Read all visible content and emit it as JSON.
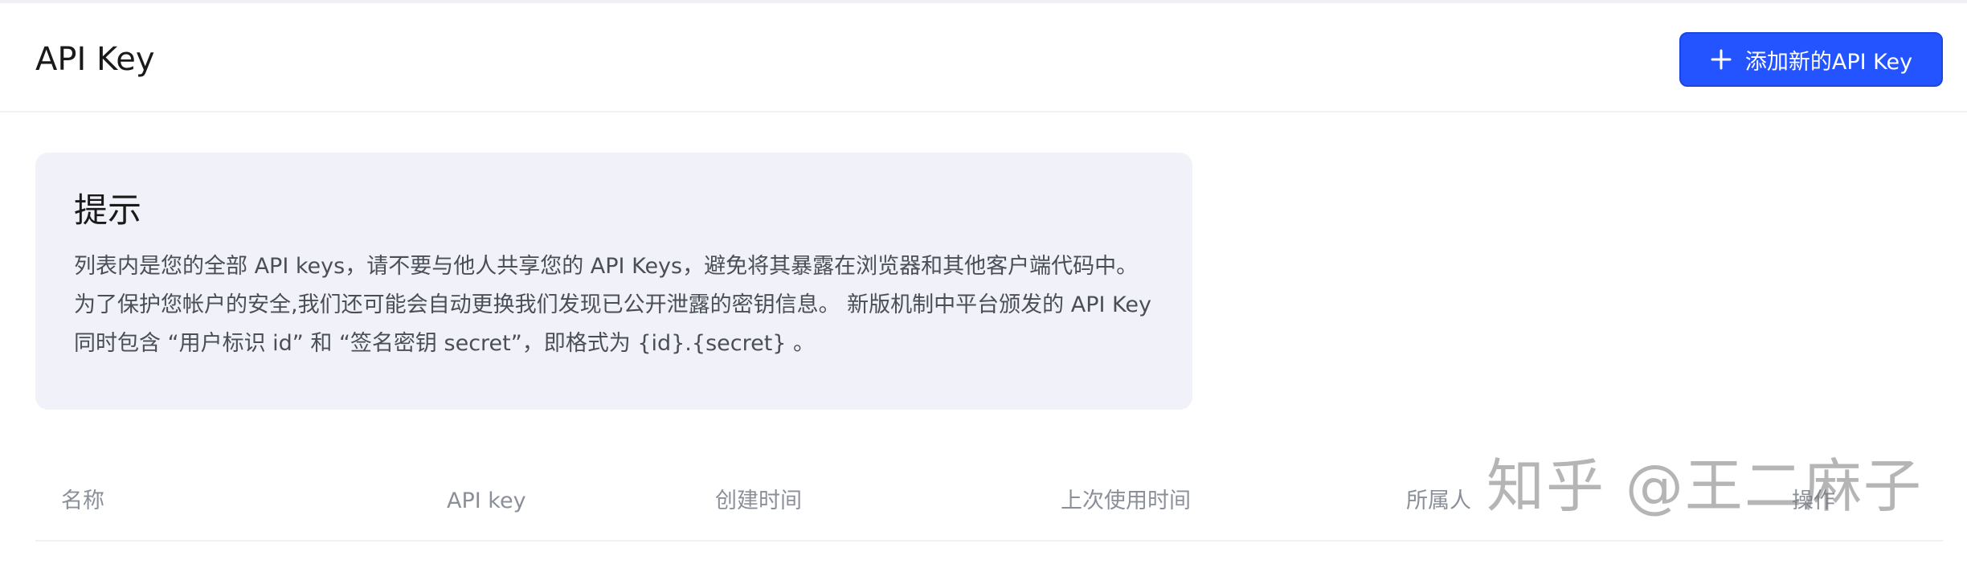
{
  "header": {
    "title": "API Key",
    "add_button_label": "添加新的API Key",
    "add_button_icon": "plus-icon"
  },
  "tip": {
    "title": "提示",
    "text": "列表内是您的全部 API keys，请不要与他人共享您的 API Keys，避免将其暴露在浏览器和其他客户端代码中。为了保护您帐户的安全,我们还可能会自动更换我们发现已公开泄露的密钥信息。 新版机制中平台颁发的 API Key 同时包含 “用户标识 id” 和 “签名密钥 secret”，即格式为 {id}.{secret} 。"
  },
  "table": {
    "columns": [
      "名称",
      "API key",
      "创建时间",
      "上次使用时间",
      "所属人",
      "操作"
    ]
  },
  "watermark": "知乎 @王二麻子",
  "colors": {
    "accent": "#2454ff",
    "tip_background": "#f1f1f9",
    "header_text": "#8a8f99"
  }
}
